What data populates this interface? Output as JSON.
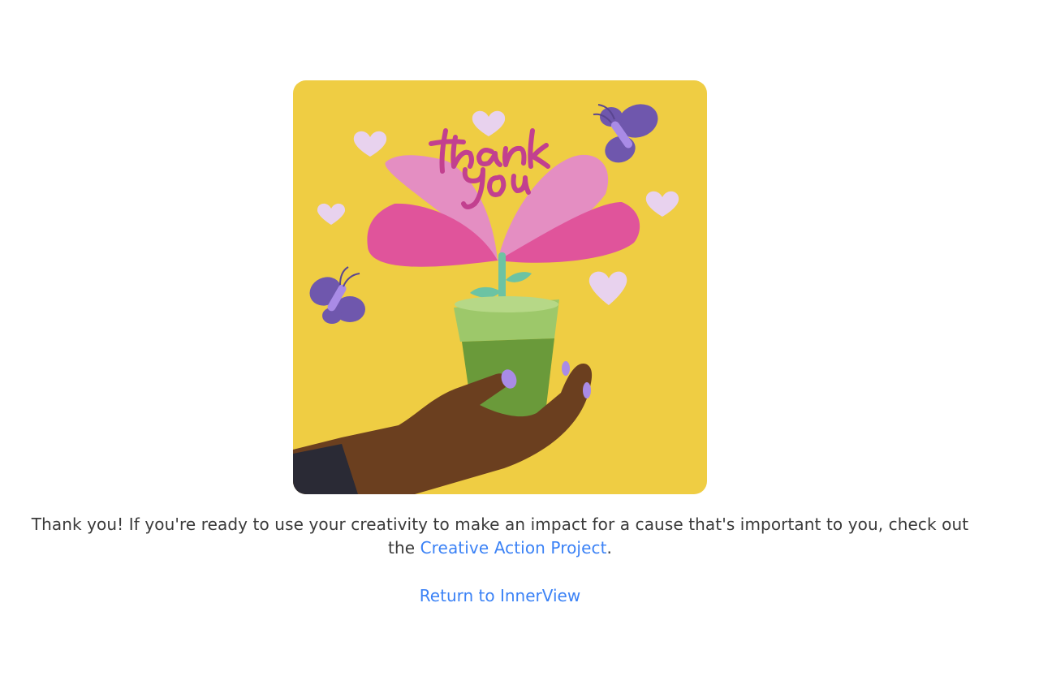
{
  "illustration": {
    "lettering": "thank you",
    "background_color": "#efcd43",
    "accent_colors": {
      "petal_light": "#e48ec2",
      "petal_dark": "#e0549b",
      "pot": "#9dc86a",
      "pot_dark": "#6a9a3a",
      "skin": "#6b3f1f",
      "nails": "#a98be6",
      "butterfly": "#6f57ad",
      "heart": "#e8d2ee"
    }
  },
  "message": {
    "text_before": "Thank you! If you're ready to use your creativity to make an impact for a cause that's important to you, check out the ",
    "link_label": "Creative Action Project",
    "text_after": "."
  },
  "return_link": {
    "label": "Return to InnerView"
  },
  "colors": {
    "link": "#3b82f6",
    "text": "#3a3a3a"
  }
}
